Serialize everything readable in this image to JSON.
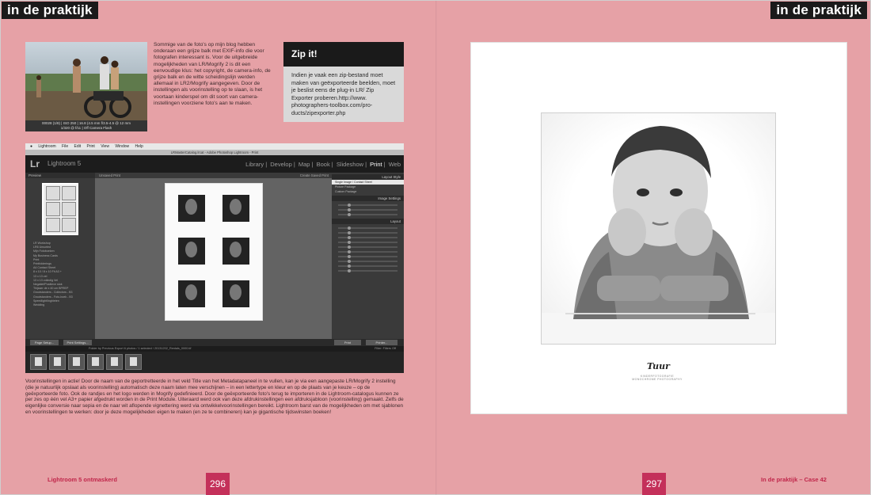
{
  "header": {
    "tag_left": "in de praktijk",
    "tag_right": "in de praktijk"
  },
  "photo": {
    "caption_line1": "00028 (1/8) | ISO 250 | 16.8 (4.5 mm f/3.5-4.5 @ 12 mm",
    "caption_line2": "1/320 @ f/11 | Off Camera Flash"
  },
  "intro": {
    "text": "Sommige van de foto's op mijn blog hebben onderaan een grijze balk met EXIF-info die voor fotografen interessant is. Voor de uitgebreide mogelijkheden van LR/Mogrify 2 is dit een eenvoudige klus: het copyright, de camera-info, de grijze balk en de witte scheidingslijn werden allemaal in LR2/Mogrify aangegeven. Door de instellingen als voorinstelling op te slaan, is het voortaan kinderspel om dit soort van camera-instellingen voorziene foto's aan te maken."
  },
  "zip": {
    "title": "Zip it!",
    "text": "Indien je vaak een zip-bestand moet maken van geëxporteerde beelden, moet je beslist eens de plug-in LR/ Zip Exporter proberen.http://www. photographers-toolbox.com/pro-ducts/zipexporter.php"
  },
  "lightroom": {
    "menu": [
      "Lightroom",
      "File",
      "Edit",
      "Print",
      "View",
      "Window",
      "Help"
    ],
    "window_title": "LRMasterCatalog.lrcat - Adobe Photoshop Lightroom - Print",
    "logo": "Lr",
    "brand": "Lightroom 5",
    "modules": [
      "Library",
      "Develop",
      "Map",
      "Book",
      "Slideshow",
      "Print",
      "Web"
    ],
    "active_module": "Print",
    "left_panel_title": "Preview",
    "collections": [
      "LR Workshop",
      "LR6 Unsorted",
      "Mijn Fotoboeken",
      "My Business Cards",
      "Print",
      "Printfolderings",
      "A4 Contact Sheet",
      "8 x 10 / 8 x 10 Fit A3 +",
      "13 x 13 vel",
      "13 x 13 volledig Vel",
      "Negatief/Positieve stok",
      "Thijsser de x 40 cm BPREP",
      "Grootstanders - Collectors - B3",
      "Grootstanders - Foto-boek - B3",
      "Speedlight/Inghieten",
      "Wedding"
    ],
    "center_title": "Unsaved Print",
    "center_right": "Create Saved Print",
    "right_panel_title": "Layout Style",
    "layout_options": [
      "Single Image / Contact Sheet",
      "Picture Package",
      "Custom Package"
    ],
    "image_settings": "Image Settings",
    "layout_label": "Layout",
    "buttons": {
      "page_setup": "Page Setup...",
      "print_settings": "Print Settings...",
      "print": "Print",
      "printer": "Printer..."
    },
    "filmstrip_info": "Folder by Previous Export    6 photos / 1 selected / 20131202_Rentals_0000.tif",
    "filmstrip_count": 6,
    "filter": "Filter: Filters Off"
  },
  "body": {
    "text": "Voorinstellingen in actie! Door de naam van de geportretteerde in het veld Title van het Metadatapaneel in te vullen, kan je via een aangepaste LR/Mogrify 2 instelling (die je natuurlijk opslaat als voorinstelling) automatisch deze naam laten mee verschijnen – in een lettertype en kleur en op de plaats van je keuze – op de geëxporteerde foto. Ook de randjes en het logo werden in Mogrify gedefinieerd. Door de geëxporteerde foto's terug te importeren in de Lightroom-catalogus kunnen ze per zes op één vel A3+ papier afgedrukt worden in de Print Module. Uiteraard werd ook van deze afdrukinstellingen een afdruksjabloon (voorinstelling) gemaakt. Zelfs de eigenlijke conversie naar sepia en de naar wit aflopende vignettering werd via ontwikkelvoorinstellingen bereikt. Lightroom barst van de mogelijkheden om met sjablonen en voorinstellingen te werken: door je deze mogelijkheden eigen te maken (en ze te combineren) kan je gigantische tijdswinsten boeken!"
  },
  "footer": {
    "left_title": "Lightroom 5 ontmaskerd",
    "left_page": "296",
    "right_page": "297",
    "right_title": "In de praktijk – Case 42"
  },
  "print_photo": {
    "signature": "Tuur",
    "studio_line1": "KINDERFOTOGRAFIE",
    "studio_line2": "MONOCHROME PHOTOGRAPHY"
  }
}
